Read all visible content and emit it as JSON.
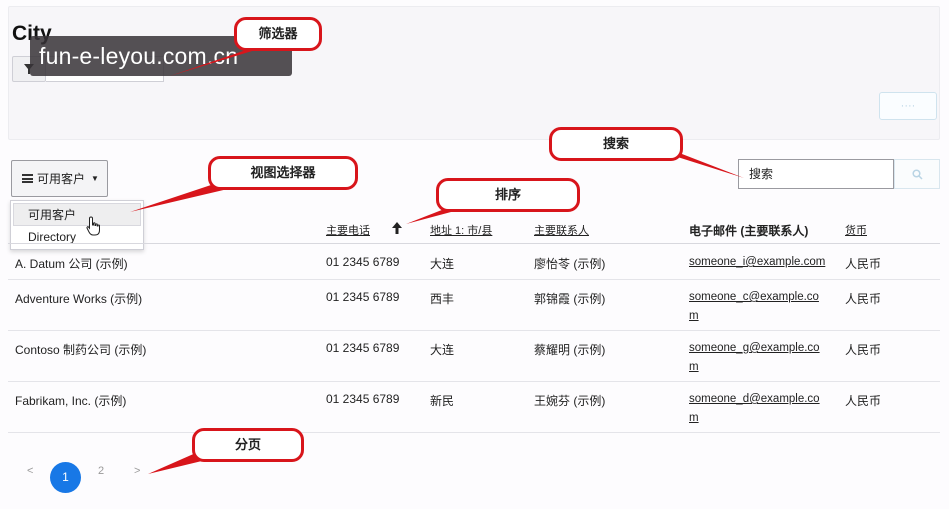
{
  "filter": {
    "title": "City",
    "apply_label": "····"
  },
  "watermark": "fun-e-leyou.com.cn",
  "view_selector": {
    "label": "可用客户",
    "menu": [
      "可用客户",
      "Directory"
    ]
  },
  "search": {
    "value": "搜索"
  },
  "grid": {
    "headers": {
      "phone": "主要电话",
      "address": "地址 1: 市/县",
      "contact": "主要联系人",
      "email": "电子邮件 (主要联系人)",
      "currency": "货币"
    },
    "rows": [
      {
        "name": "A. Datum 公司 (示例)",
        "phone": "01 2345 6789",
        "city": "大连",
        "contact": "廖怡苓 (示例)",
        "email": [
          "someone_i@example.com"
        ],
        "currency": "人民币"
      },
      {
        "name": "Adventure Works (示例)",
        "phone": "01 2345 6789",
        "city": "西丰",
        "contact": "郭锦霞 (示例)",
        "email": [
          "someone_c@example.co",
          "m"
        ],
        "currency": "人民币"
      },
      {
        "name": "Contoso 制药公司 (示例)",
        "phone": "01 2345 6789",
        "city": "大连",
        "contact": "蔡耀明 (示例)",
        "email": [
          "someone_g@example.co",
          "m"
        ],
        "currency": "人民币"
      },
      {
        "name": "Fabrikam, Inc. (示例)",
        "phone": "01 2345 6789",
        "city": "新民",
        "contact": "王婉芬 (示例)",
        "email": [
          "someone_d@example.co",
          "m"
        ],
        "currency": "人民币"
      }
    ]
  },
  "pagination": {
    "prev": "<",
    "current": "1",
    "next_page": "2",
    "next": ">"
  },
  "callouts": {
    "filter": "筛选器",
    "search": "搜索",
    "view": "视图选择器",
    "sort": "排序",
    "paging": "分页"
  },
  "colors": {
    "callout_border": "#d8151b",
    "page_active": "#1878e6"
  }
}
